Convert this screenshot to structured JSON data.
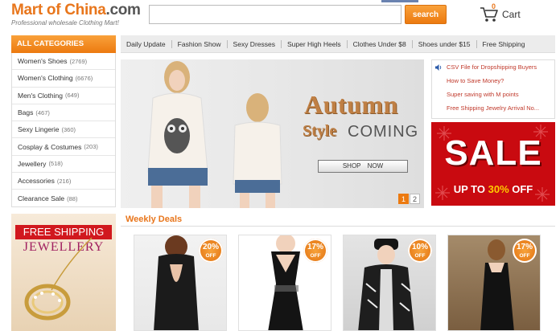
{
  "logo": {
    "main_a": "Mart of ",
    "main_b": "China",
    "main_c": ".com",
    "tagline": "Professional wholesale Clothing Mart!"
  },
  "search": {
    "value": "",
    "placeholder": "",
    "button_label": "search"
  },
  "cart": {
    "count": "0",
    "label": "Cart"
  },
  "categories": {
    "header": "ALL CATEGORIES",
    "items": [
      {
        "label": "Women's Shoes",
        "count": "(2769)"
      },
      {
        "label": "Women's Clothing",
        "count": "(6676)"
      },
      {
        "label": "Men's Clothing",
        "count": "(649)"
      },
      {
        "label": "Bags",
        "count": "(467)"
      },
      {
        "label": "Sexy Lingerie",
        "count": "(360)"
      },
      {
        "label": "Cosplay & Costumes",
        "count": "(203)"
      },
      {
        "label": "Jewellery",
        "count": "(518)"
      },
      {
        "label": "Accessories",
        "count": "(216)"
      },
      {
        "label": "Clearance Sale",
        "count": "(88)"
      }
    ]
  },
  "nav": {
    "items": [
      "Daily Update",
      "Fashion Show",
      "Sexy Dresses",
      "Super High Heels",
      "Clothes Under $8",
      "Shoes under $15",
      "Free Shipping"
    ]
  },
  "banner": {
    "title": "Autumn",
    "sub_style": "Style",
    "sub_coming": "COMING",
    "button": "SHOP NOW",
    "pages": [
      "1",
      "2"
    ],
    "active_page": "1"
  },
  "news": {
    "items": [
      "CSV File for Dropshipping Buyers",
      "How to Save Money?",
      "Super saving with M points",
      "Free Shipping Jewelry Arrival No..."
    ]
  },
  "sale": {
    "word": "SALE",
    "prefix": "UP TO ",
    "pct": "30%",
    "suffix": " OFF"
  },
  "promo": {
    "shipping": "FREE SHIPPING",
    "jewellery": "JEWELLERY"
  },
  "weekly": {
    "title": "Weekly Deals",
    "products": [
      {
        "pct": "20%",
        "off": "OFF"
      },
      {
        "pct": "17%",
        "off": "OFF"
      },
      {
        "pct": "10%",
        "off": "OFF"
      },
      {
        "pct": "17%",
        "off": "OFF"
      }
    ]
  },
  "colors": {
    "accent": "#ec7a10",
    "sale_red": "#c90a10",
    "news_text": "#c0392b"
  }
}
